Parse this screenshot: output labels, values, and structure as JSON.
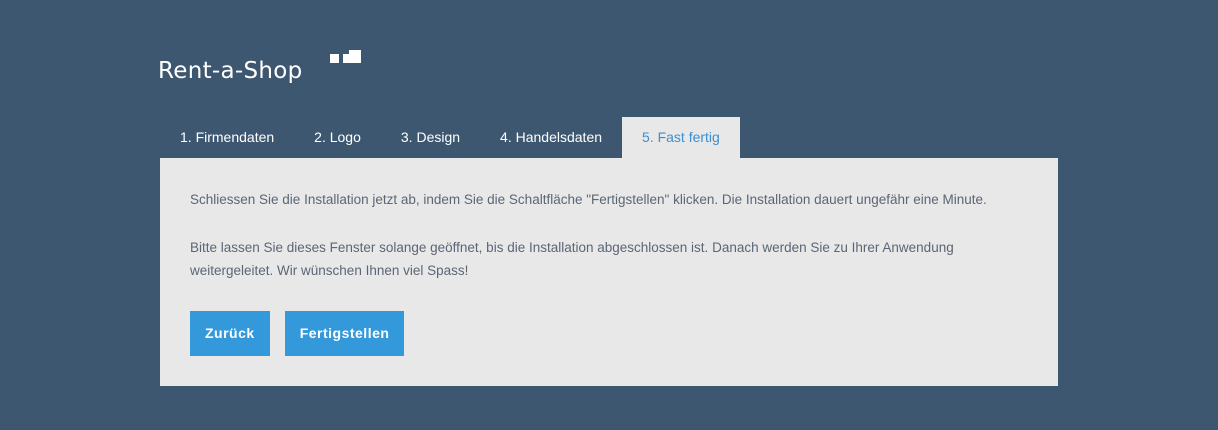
{
  "brand": {
    "logo_text": "Rent-a-Shop",
    "color": "#ffffff"
  },
  "tabs": [
    {
      "label": "1. Firmendaten",
      "active": false
    },
    {
      "label": "2. Logo",
      "active": false
    },
    {
      "label": "3. Design",
      "active": false
    },
    {
      "label": "4. Handelsdaten",
      "active": false
    },
    {
      "label": "5. Fast fertig",
      "active": true
    }
  ],
  "panel": {
    "paragraph1": "Schliessen Sie die Installation jetzt ab, indem Sie die Schaltfläche \"Fertigstellen\" klicken. Die Installation dauert ungefähr eine Minute.",
    "paragraph2": "Bitte lassen Sie dieses Fenster solange geöffnet, bis die Installation abgeschlossen ist. Danach werden Sie zu Ihrer Anwendung weitergeleitet. Wir wünschen Ihnen viel Spass!"
  },
  "buttons": {
    "back_label": "Zurück",
    "finish_label": "Fertigstellen"
  },
  "colors": {
    "background": "#3e5771",
    "panel": "#e8e8e8",
    "accent": "#3499db",
    "active_tab_text": "#3d8fd0",
    "body_text": "#5b6675"
  }
}
